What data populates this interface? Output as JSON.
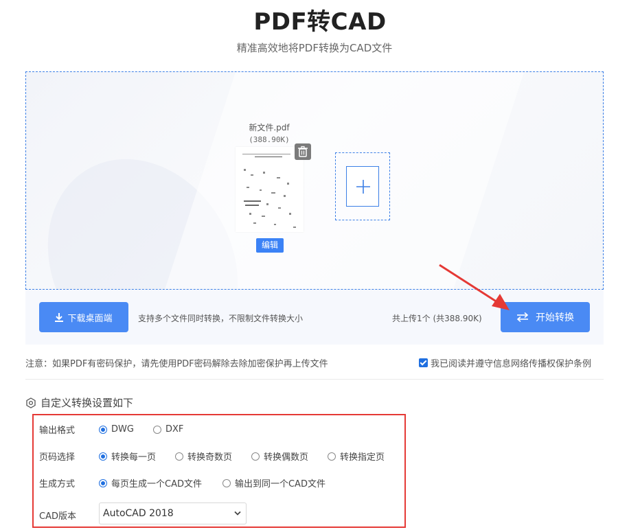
{
  "header": {
    "title": "PDF转CAD",
    "subtitle": "精准高效地将PDF转换为CAD文件"
  },
  "upload": {
    "file_name": "新文件.pdf",
    "file_size": "(388.90K)",
    "edit_label": "编辑",
    "icons": {
      "delete": "trash-icon",
      "add": "plus-icon"
    }
  },
  "actions": {
    "download_label": "下载桌面端",
    "support_text": "支持多个文件同时转换，不限制文件转换大小",
    "count_text": "共上传1个 (共388.90K)",
    "start_label": "开始转换"
  },
  "notice": {
    "text": "注意：如果PDF有密码保护，请先使用PDF密码解除去除加密保护再上传文件",
    "agree_label": "我已阅读并遵守信息网络传播权保护条例",
    "agree_checked": true
  },
  "settings": {
    "title": "自定义转换设置如下",
    "output_format": {
      "label": "输出格式",
      "options": [
        "DWG",
        "DXF"
      ],
      "selected": "DWG"
    },
    "page_select": {
      "label": "页码选择",
      "options": [
        "转换每一页",
        "转换奇数页",
        "转换偶数页",
        "转换指定页"
      ],
      "selected": "转换每一页"
    },
    "generate_mode": {
      "label": "生成方式",
      "options": [
        "每页生成一个CAD文件",
        "输出到同一个CAD文件"
      ],
      "selected": "每页生成一个CAD文件"
    },
    "cad_version": {
      "label": "CAD版本",
      "value": "AutoCAD 2018"
    }
  },
  "colors": {
    "accent": "#4a8af4",
    "border_dashed": "#3b7fe6",
    "highlight": "#e53935"
  }
}
